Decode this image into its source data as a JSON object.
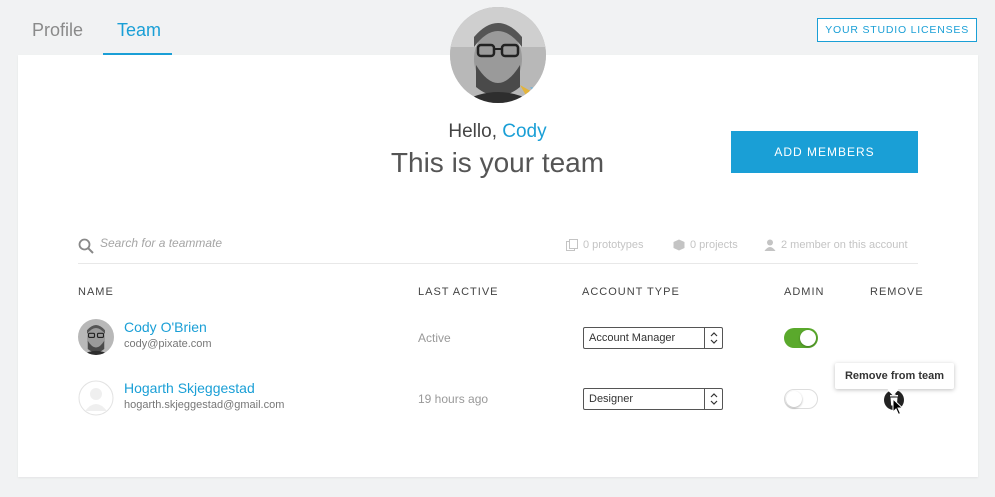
{
  "tabs": {
    "profile": "Profile",
    "team": "Team"
  },
  "header": {
    "licenses_button": "YOUR STUDIO LICENSES"
  },
  "hero": {
    "greeting": "Hello,",
    "user_name": "Cody",
    "subtitle": "This is your team"
  },
  "actions": {
    "add_members": "ADD MEMBERS"
  },
  "search": {
    "placeholder": "Search for a teammate"
  },
  "stats": {
    "prototypes": "0 prototypes",
    "projects": "0 projects",
    "members": "2 member on this account"
  },
  "table": {
    "headers": {
      "name": "NAME",
      "last_active": "LAST ACTIVE",
      "account_type": "ACCOUNT TYPE",
      "admin": "ADMIN",
      "remove": "REMOVE"
    },
    "rows": [
      {
        "name": "Cody O'Brien",
        "email": "cody@pixate.com",
        "last_active": "Active",
        "account_type": "Account Manager",
        "admin": true
      },
      {
        "name": "Hogarth Skjeggestad",
        "email": "hogarth.skjeggestad@gmail.com",
        "last_active": "19 hours ago",
        "account_type": "Designer",
        "admin": false
      }
    ]
  },
  "tooltip": {
    "remove_text": "Remove from team"
  },
  "colors": {
    "accent": "#1a9fd6",
    "toggle_on": "#5aa92c",
    "background": "#f1f2f3"
  }
}
